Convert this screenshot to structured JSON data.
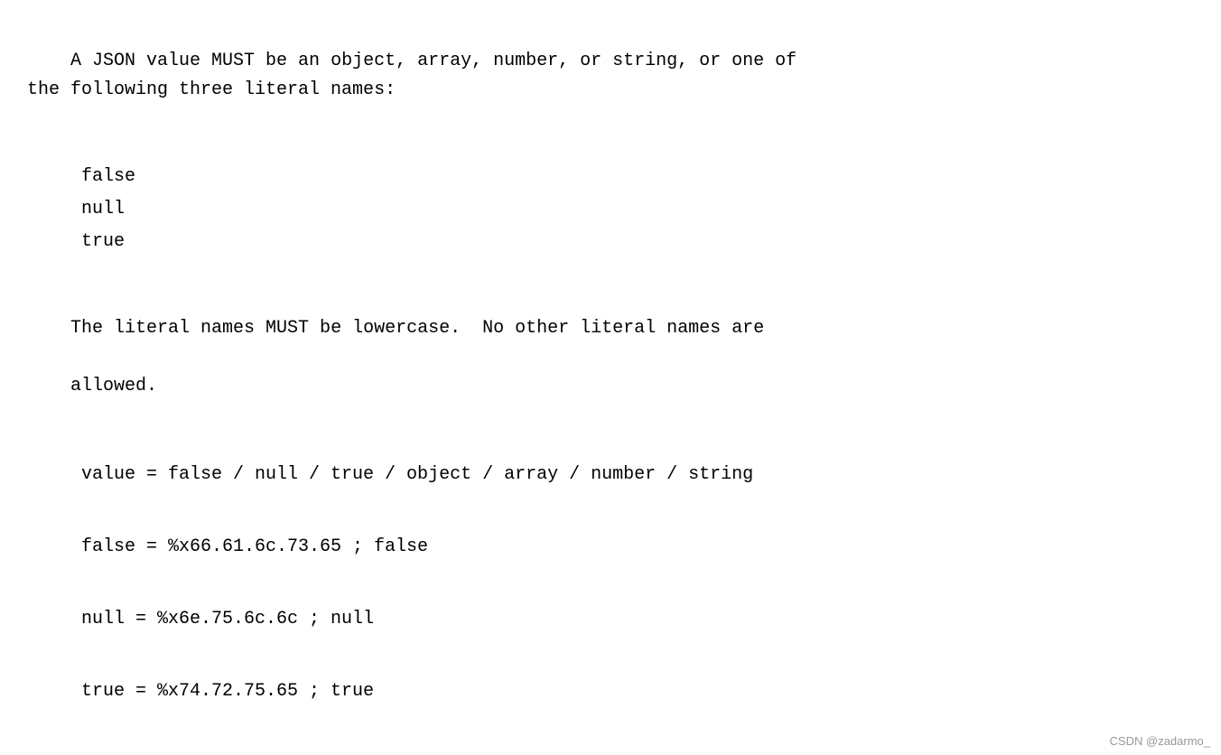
{
  "content": {
    "paragraph1": "A JSON value MUST be an object, array, number, or string, or one of\nthe following three literal names:",
    "literal_names": [
      "false",
      "null",
      "true"
    ],
    "paragraph2_line1": "The literal names MUST be lowercase.  No other literal names are",
    "paragraph2_line2": "allowed.",
    "grammar_rules": [
      "value = false / null / true / object / array / number / string",
      "false = %x66.61.6c.73.65    ; false",
      "null  = %x6e.75.6c.6c       ; null",
      "true  = %x74.72.75.65       ; true"
    ],
    "watermark": "CSDN @zadarmo_"
  }
}
